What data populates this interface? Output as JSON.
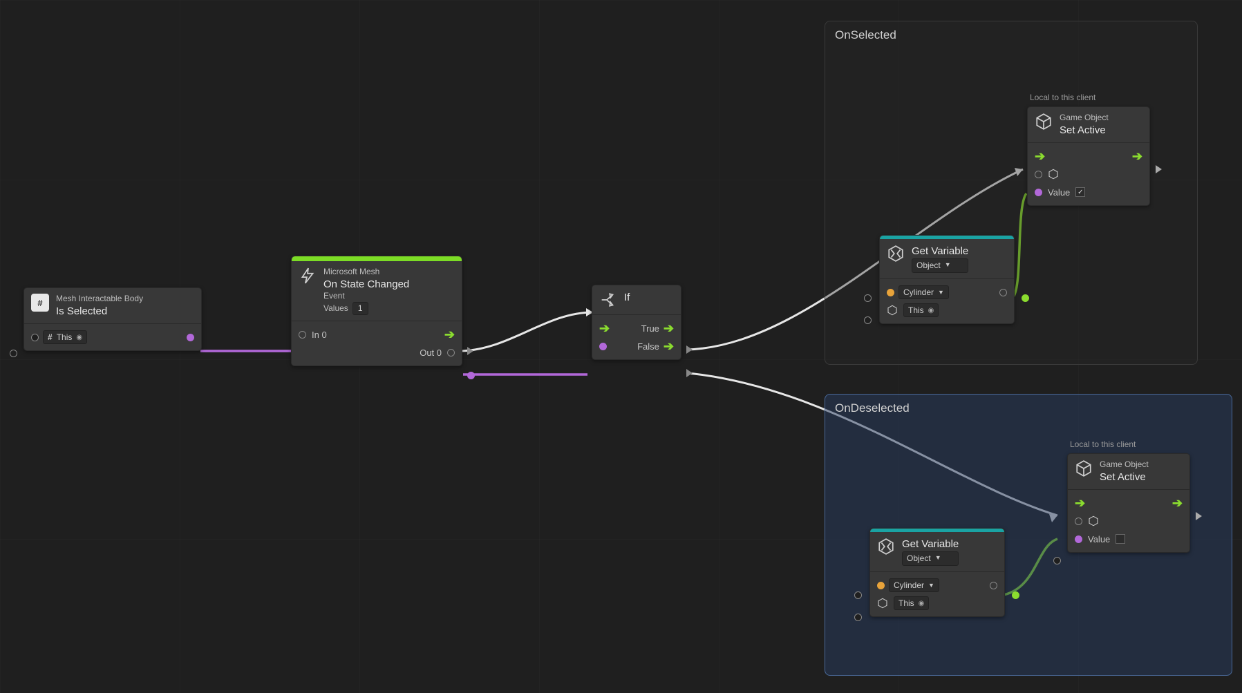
{
  "node_is_selected": {
    "subtitle": "Mesh Interactable Body",
    "title": "Is Selected",
    "target": "This"
  },
  "node_on_state_changed": {
    "subtitle": "Microsoft Mesh",
    "title": "On State Changed",
    "line3": "Event",
    "values_label": "Values",
    "values_count": "1",
    "in_label": "In 0",
    "out_label": "Out 0"
  },
  "node_if": {
    "title": "If",
    "true_label": "True",
    "false_label": "False"
  },
  "group_on_selected": {
    "title": "OnSelected"
  },
  "group_on_deselected": {
    "title": "OnDeselected"
  },
  "hint_local": "Local to this client",
  "node_set_active_1": {
    "subtitle": "Game Object",
    "title": "Set Active",
    "value_label": "Value",
    "checked": true
  },
  "node_set_active_2": {
    "subtitle": "Game Object",
    "title": "Set Active",
    "value_label": "Value",
    "checked": false
  },
  "node_get_var": {
    "title": "Get Variable",
    "scope": "Object",
    "var_name": "Cylinder",
    "target": "This"
  }
}
